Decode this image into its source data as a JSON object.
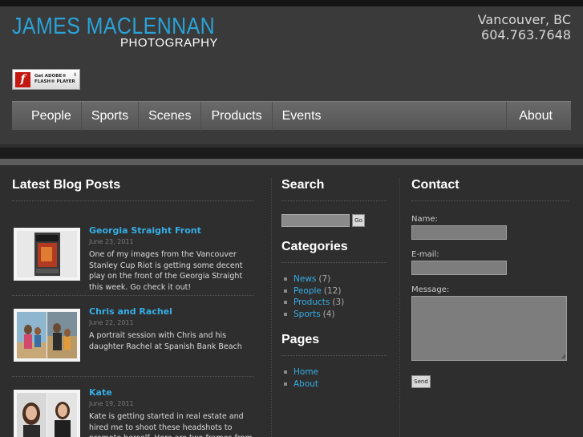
{
  "brand": {
    "name": "JAMES MACLENNAN",
    "tagline": "PHOTOGRAPHY",
    "location": "Vancouver, BC",
    "phone": "604.763.7648"
  },
  "flash_badge": {
    "line1": "Get ADOBE®",
    "line2": "FLASH® PLAYER",
    "icon": "flash-player-icon"
  },
  "nav": {
    "items": [
      "People",
      "Sports",
      "Scenes",
      "Products",
      "Events"
    ],
    "right_item": "About"
  },
  "blog": {
    "heading": "Latest Blog Posts",
    "posts": [
      {
        "title": "Georgia Straight Front",
        "date": "June 23, 2011",
        "text": "One of my images from the Vancouver Stanley Cup Riot is getting some decent play on the front of the Georgia Straight this week. Go check it out!"
      },
      {
        "title": "Chris and Rachel",
        "date": "June 22, 2011",
        "text": "A portrait session with Chris and his daughter Rachel at Spanish Bank Beach"
      },
      {
        "title": "Kate",
        "date": "June 19, 2011",
        "text": "Kate is getting started in real estate and hired me to shoot these headshots to promote herself. Here are two frames from the shoot"
      }
    ]
  },
  "search": {
    "heading": "Search",
    "button": "Go",
    "value": ""
  },
  "categories": {
    "heading": "Categories",
    "items": [
      {
        "label": "News",
        "count": "(7)"
      },
      {
        "label": "People",
        "count": "(12)"
      },
      {
        "label": "Products",
        "count": "(3)"
      },
      {
        "label": "Sports",
        "count": "(4)"
      }
    ]
  },
  "pages": {
    "heading": "Pages",
    "items": [
      "Home",
      "About"
    ]
  },
  "contact": {
    "heading": "Contact",
    "name_label": "Name:",
    "email_label": "E-mail:",
    "message_label": "Message:",
    "send_label": "Send"
  },
  "colors": {
    "accent": "#29a3d9",
    "link": "#35aee5",
    "background": "#2e2e2e",
    "nav": "#5f5f5f"
  }
}
